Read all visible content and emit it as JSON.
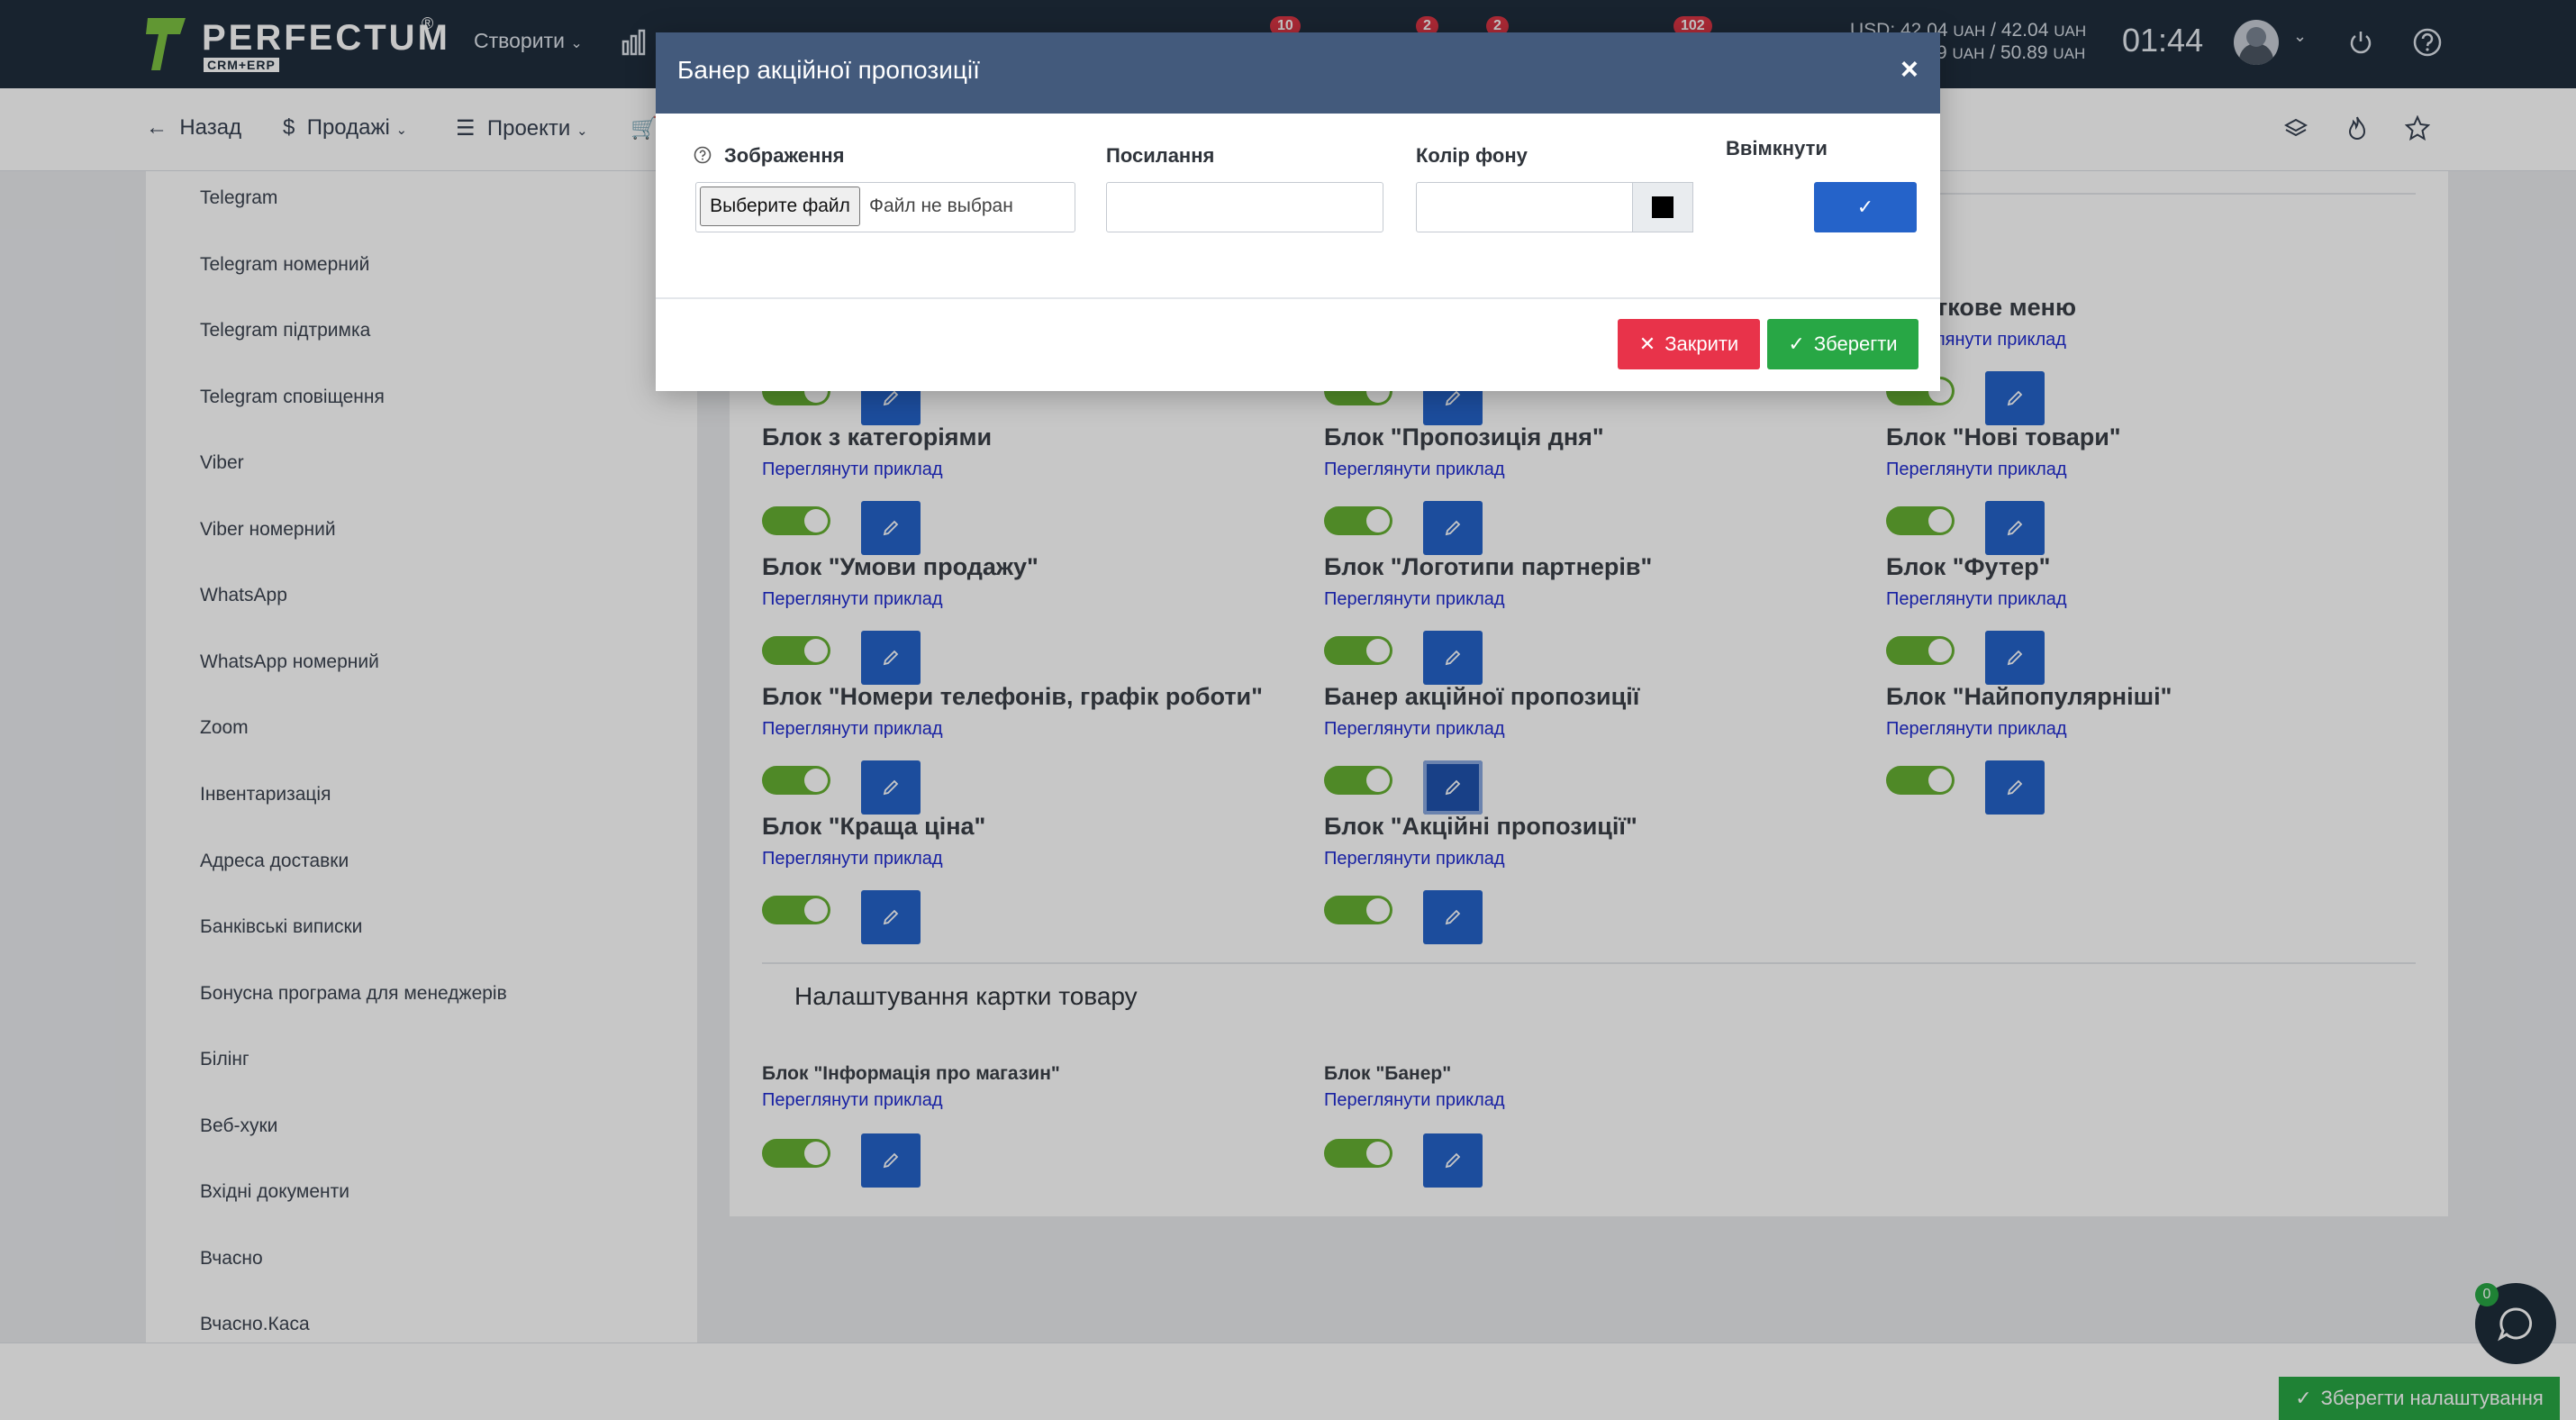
{
  "navbar": {
    "logo_text": "PERFECTUM",
    "logo_sub": "CRM+ERP",
    "logo_reg": "®",
    "create_label": "Створити",
    "badges": [
      "10",
      "2",
      "2",
      "102"
    ],
    "currency_usd": "USD: 42.04",
    "currency_usd_unit": "UAH",
    "currency_usd_b": "/ 42.04",
    "currency_eur": "9",
    "currency_eur_unit": "UAH",
    "currency_eur_b": "/ 50.89",
    "clock": "01:44"
  },
  "subnav": {
    "back": "Назад",
    "sales": "Продажі",
    "projects": "Проекти"
  },
  "sidebar": {
    "items": [
      "Telegram",
      "Telegram номерний",
      "Telegram підтримка",
      "Telegram сповіщення",
      "Viber",
      "Viber номерний",
      "WhatsApp",
      "WhatsApp номерний",
      "Zoom",
      "Інвентаризація",
      "Адреса доставки",
      "Банківські виписки",
      "Бонусна програма для менеджерів",
      "Білінг",
      "Веб-хуки",
      "Вхідні документи",
      "Вчасно",
      "Вчасно.Каса"
    ]
  },
  "panel": {
    "view_example": "Переглянути приклад",
    "partial_title": "аткове меню",
    "partial_link": "еглянути приклад",
    "blocks": [
      "Блок з категоріями",
      "Блок \"Пропозиція дня\"",
      "Блок \"Нові товари\"",
      "Блок \"Умови продажу\"",
      "Блок \"Логотипи партнерів\"",
      "Блок \"Футер\"",
      "Блок \"Номери телефонів, графік роботи\"",
      "Банер акційної пропозиції",
      "Блок \"Найпопулярніші\"",
      "Блок \"Краща ціна\"",
      "Блок \"Акційні пропозиції\""
    ],
    "product_card_title": "Налаштування картки товару",
    "product_blocks": [
      "Блок \"Інформація про магазин\"",
      "Блок \"Банер\""
    ]
  },
  "footer": {
    "save_settings": "Зберегти налаштування",
    "chat_badge": "0"
  },
  "modal": {
    "title": "Банер акційної пропозиції",
    "close_x": "×",
    "image_label": "Зображення",
    "file_button": "Выберите файл",
    "file_status": "Файл не выбран",
    "link_label": "Посилання",
    "link_value": "",
    "bg_color_label": "Колір фону",
    "bg_color_value": "",
    "bg_color_swatch": "#000000",
    "enable_label": "Ввімкнути",
    "close_button": "Закрити",
    "save_button": "Зберегти"
  }
}
